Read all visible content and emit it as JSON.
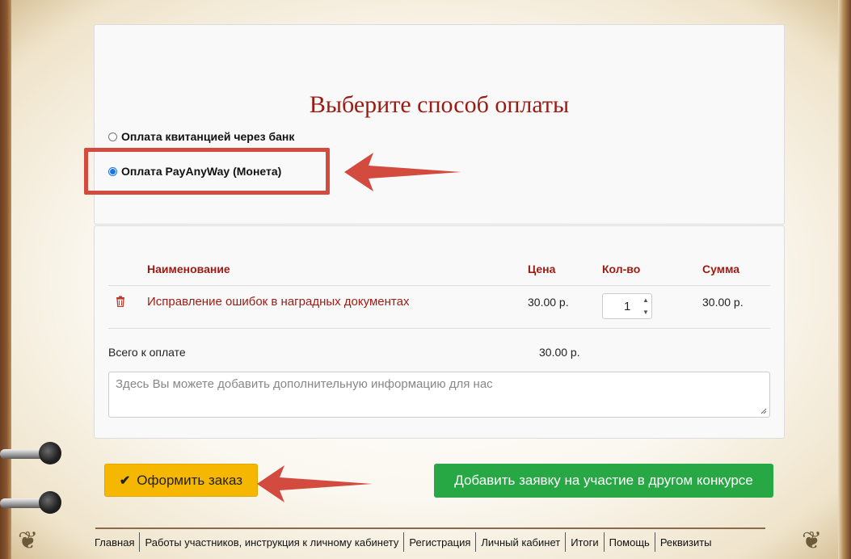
{
  "payment": {
    "title": "Выберите способ оплаты",
    "options": [
      {
        "label": "Оплата квитанцией через банк",
        "selected": false
      },
      {
        "label": "Оплата PayAnyWay (Монета)",
        "selected": true
      }
    ]
  },
  "order_table": {
    "columns": [
      "Наименование",
      "Цена",
      "Кол-во",
      "Сумма"
    ],
    "rows": [
      {
        "name": "Исправление ошибок в наградных документах",
        "price": "30.00 р.",
        "qty": "1",
        "sum": "30.00 р."
      }
    ],
    "total_label": "Всего к оплате",
    "total_value": "30.00 р."
  },
  "notes": {
    "placeholder": "Здесь Вы можете добавить дополнительную информацию для нас"
  },
  "buttons": {
    "order": "Оформить заказ",
    "add_application": "Добавить заявку на участие в другом конкурсе"
  },
  "footer": {
    "links": [
      "Главная",
      "Работы участников, инструкция к личному кабинету",
      "Регистрация",
      "Личный кабинет",
      "Итоги",
      "Помощь",
      "Реквизиты"
    ]
  },
  "colors": {
    "accent": "#9b1b12",
    "annotation": "#d24b3e",
    "order_button": "#f5b700",
    "add_button": "#28a745"
  },
  "icons": [
    "trash-icon",
    "check-icon",
    "spinner-icon",
    "resize-grip-icon",
    "ornament-icon"
  ]
}
